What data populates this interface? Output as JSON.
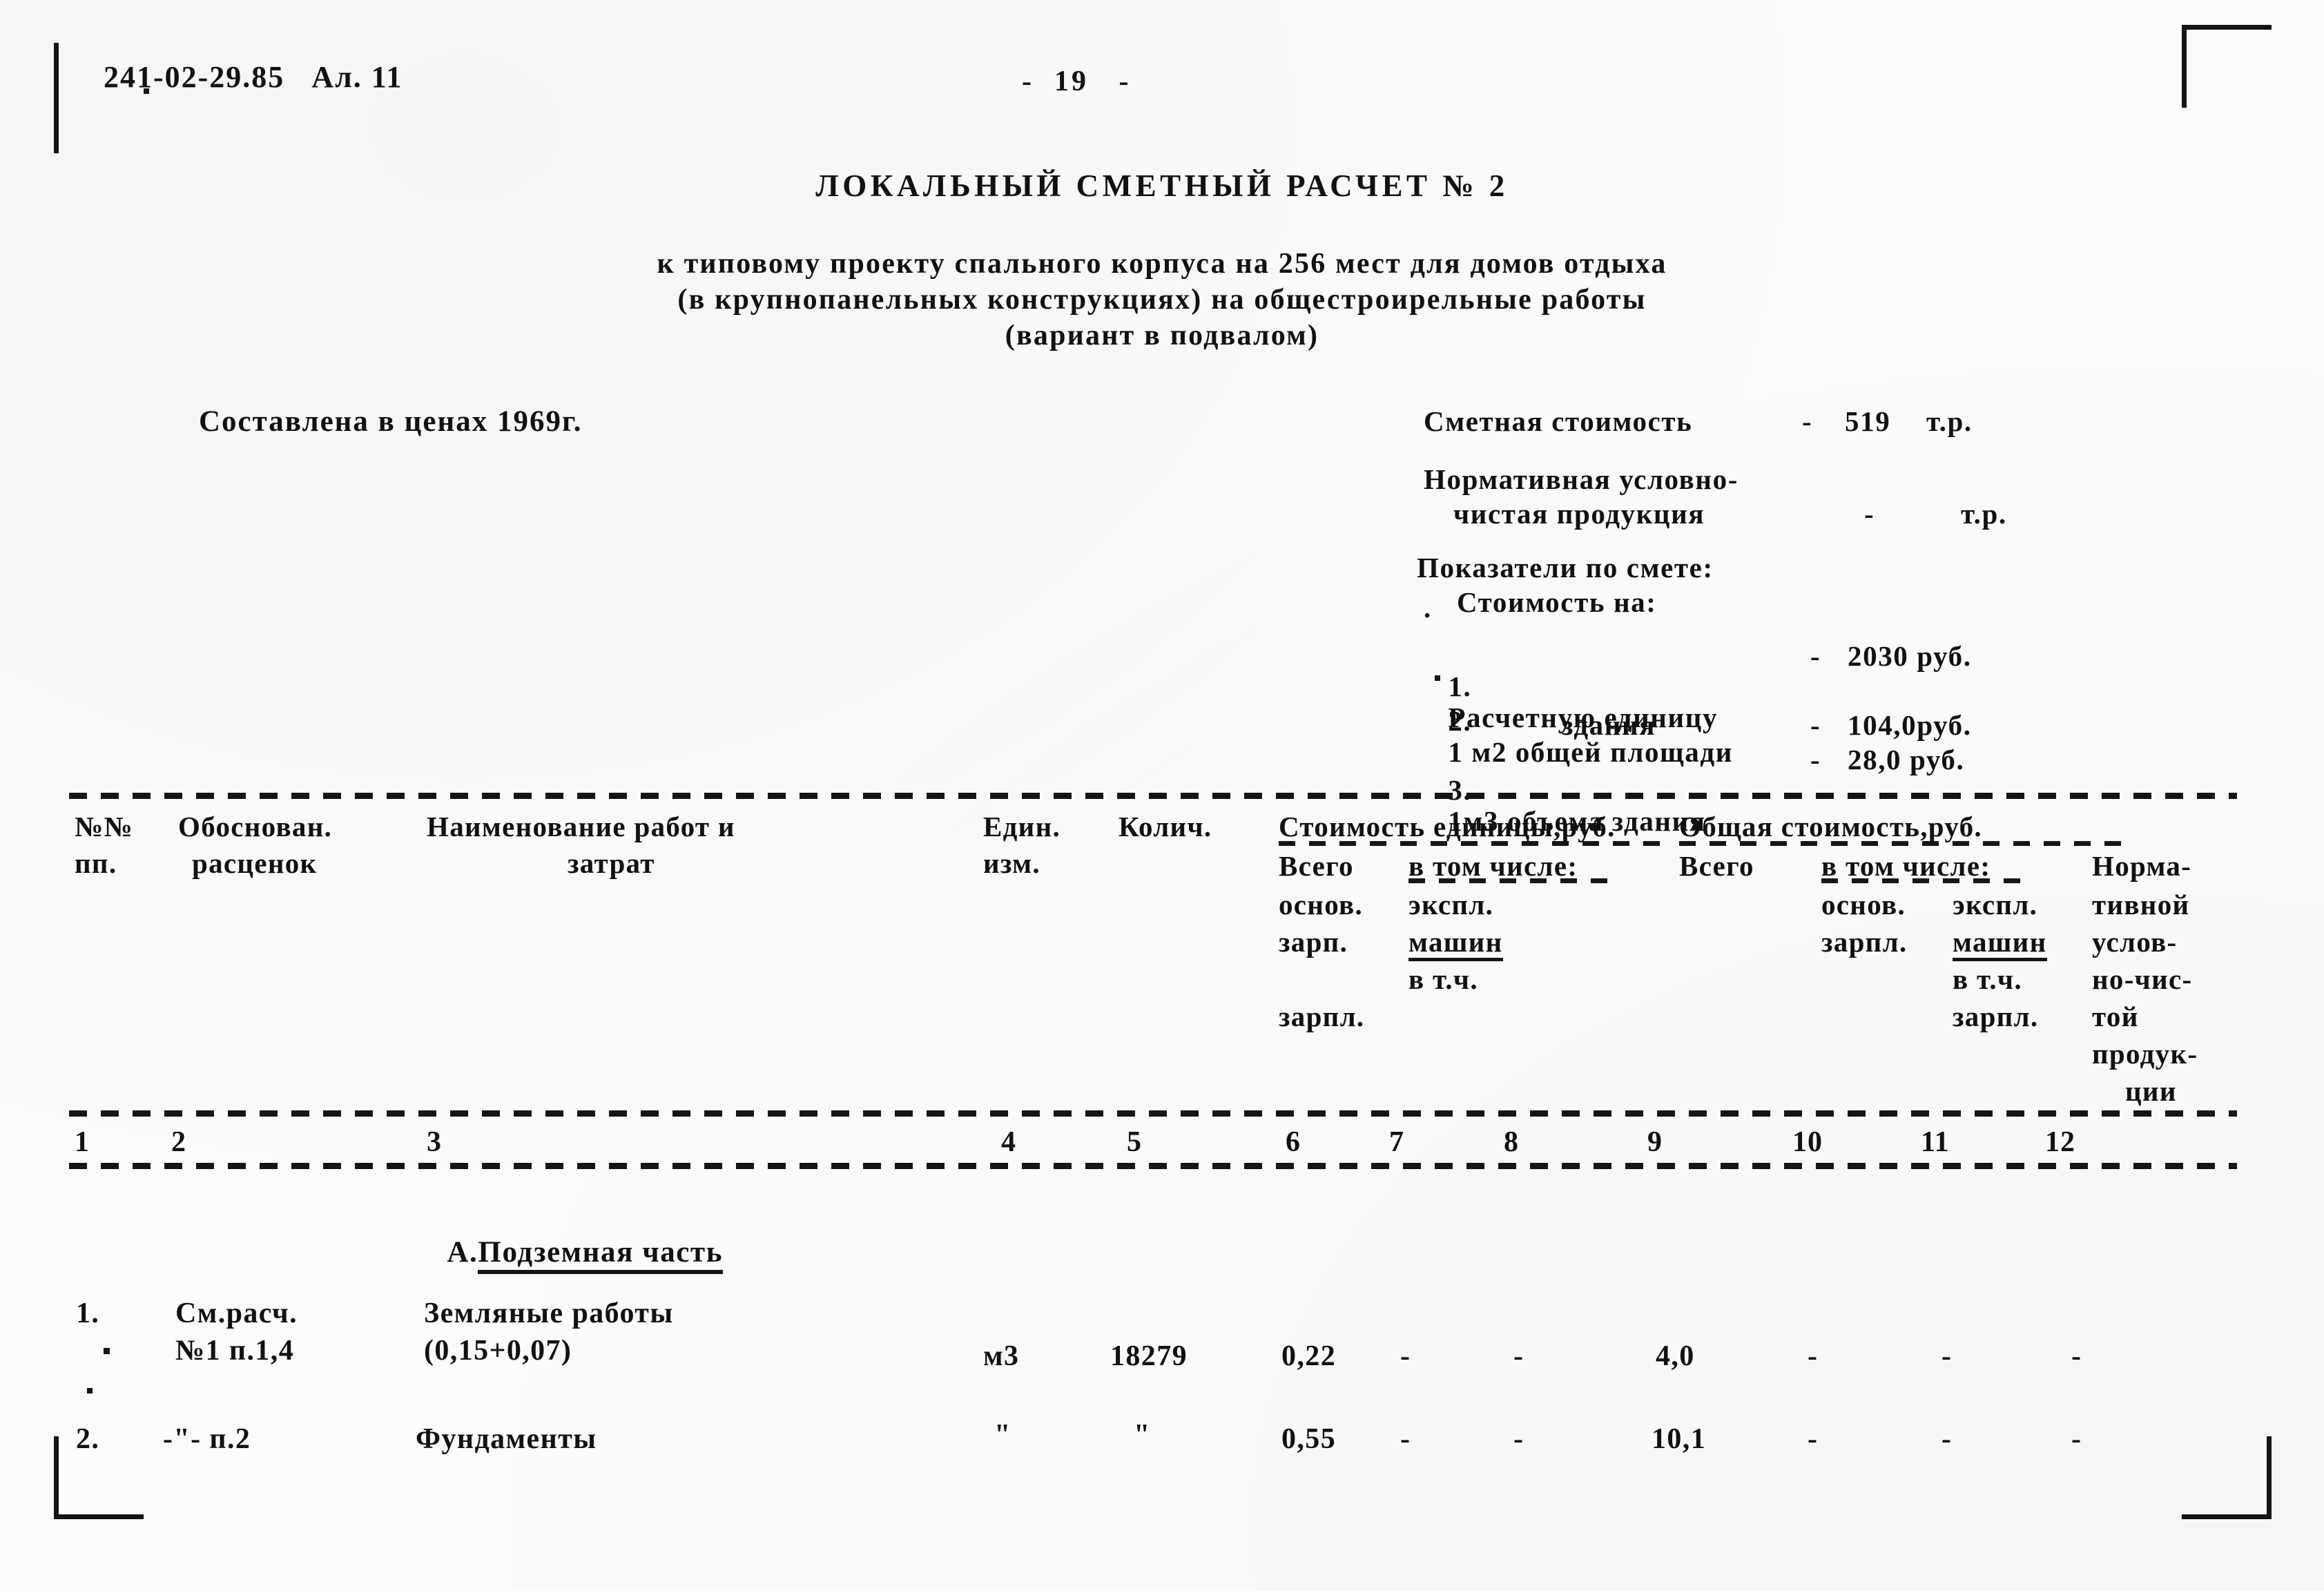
{
  "header": {
    "doc_code": "241-02-29.85   Ал. 11",
    "page_number": "-  19   -"
  },
  "title": {
    "main": "ЛОКАЛЬНЫЙ СМЕТНЫЙ РАСЧЕТ № 2",
    "sub_line1": "к типовому проекту спального корпуса на 256 мест для домов отдыха",
    "sub_line2": "(в крупнопанельных конструкциях) на общестроирельные работы",
    "sub_line3": "(вариант в подвалом)"
  },
  "prices_note": "Составлена в ценах 1969г.",
  "summary": {
    "estimate_cost_label": "Сметная стоимость",
    "estimate_cost_dash": "-",
    "estimate_cost_value": "519",
    "estimate_cost_unit": "т.р.",
    "nvcp_label_line1": "Нормативная условно-",
    "nvcp_label_line2": "чистая продукция",
    "nvcp_dash": "-",
    "nvcp_unit": "т.р.",
    "indicators_title": "Показатели по смете:",
    "indicators_subtitle": "Стоимость на:",
    "stray_dot": ".",
    "indicators": [
      {
        "no": "1.",
        "label": "Расчетную единицу",
        "dash": "-",
        "value": "2030 руб."
      },
      {
        "no": "2.",
        "label": "1 м2 общей площади",
        "label2": "здания",
        "dash": "-",
        "value": "104,0руб."
      },
      {
        "no": "3.",
        "label": "1м3 объема здания",
        "dash": "-",
        "value": "28,0 руб."
      }
    ]
  },
  "table": {
    "headers": {
      "col1_l1": "№№",
      "col1_l2": "пп.",
      "col2_l1": "Обоснован.",
      "col2_l2": "расценок",
      "col3_l1": "Наименование работ и",
      "col3_l2": "затрат",
      "col4_l1": "Един.",
      "col4_l2": "изм.",
      "col5_l1": "Колич.",
      "group_unit_cost": "Стоимость единицы,руб.",
      "group_total_cost": "Общая стоимость,руб.",
      "unit_total": "Всего",
      "unit_incl": "в том числе:",
      "unit_sub1": "основ.",
      "unit_sub2": "экспл.",
      "unit_sub3": "зарп.",
      "unit_sub4": "машин",
      "unit_sub5": "в т.ч.",
      "unit_sub6": "зарпл.",
      "total_total": "Всего",
      "total_incl": "в том числе:",
      "total_sub1": "основ.",
      "total_sub2": "экспл.",
      "total_sub3": "зарпл.",
      "total_sub4": "машин",
      "total_sub5": "в т.ч.",
      "total_sub6": "зарпл.",
      "nvcp_l1": "Норма-",
      "nvcp_l2": "тивной",
      "nvcp_l3": "услов-",
      "nvcp_l4": "но-чис-",
      "nvcp_l5": "той",
      "nvcp_l6": "продук-",
      "nvcp_l7": "ции"
    },
    "column_numbers": [
      "1",
      "2",
      "3",
      "4",
      "5",
      "6",
      "7",
      "8",
      "9",
      "10",
      "11",
      "12"
    ],
    "section_heading_prefix": "А.",
    "section_heading_underlined": "Подземная часть",
    "rows": [
      {
        "no": "1.",
        "basis_l1": "См.расч.",
        "basis_l2": "№1 п.1,4",
        "name_l1": "Земляные работы",
        "name_l2": "(0,15+0,07)",
        "unit": "м3",
        "qty": "18279",
        "c6": "0,22",
        "c7": "-",
        "c8": "-",
        "c9": "4,0",
        "c10": "-",
        "c11": "-",
        "c12": "-"
      },
      {
        "no": "2.",
        "basis_l1": "-\"- п.2",
        "basis_l2": "",
        "name_l1": "Фундаменты",
        "name_l2": "",
        "unit": "\"",
        "qty": "\"",
        "c6": "0,55",
        "c7": "-",
        "c8": "-",
        "c9": "10,1",
        "c10": "-",
        "c11": "-",
        "c12": "-"
      }
    ]
  }
}
